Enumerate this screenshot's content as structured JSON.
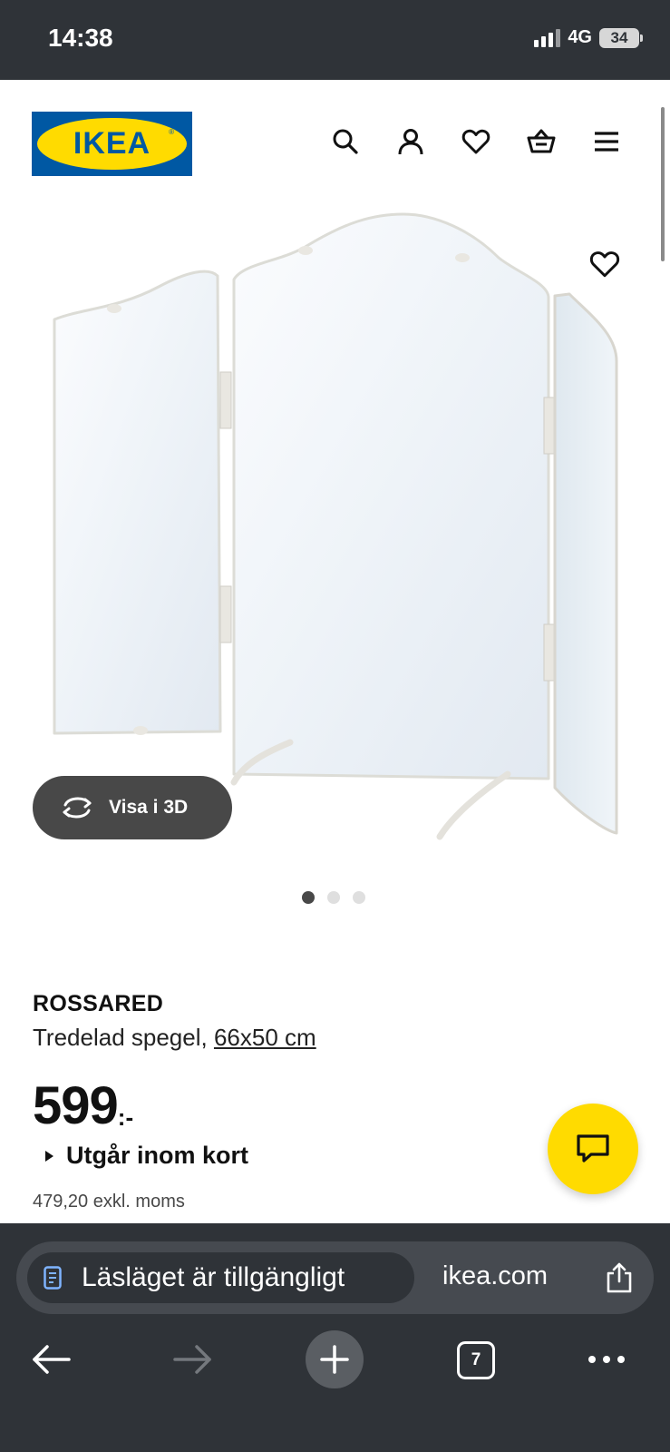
{
  "status_bar": {
    "time": "14:38",
    "network": "4G",
    "battery": "34"
  },
  "header": {
    "logo_text": "IKEA",
    "logo_reg": "®",
    "icons": [
      "search-icon",
      "account-icon",
      "wishlist-icon",
      "cart-icon",
      "menu-icon"
    ]
  },
  "gallery": {
    "view_3d_label": "Visa i 3D",
    "image_count": 3,
    "active_index": 0
  },
  "product": {
    "name": "ROSSARED",
    "description": "Tredelad spegel,",
    "size_link": "66x50 cm",
    "price": "599",
    "price_suffix": ":-",
    "availability": "Utgår inom kort",
    "price_ex_vat": "479,20 exkl. moms"
  },
  "browser": {
    "reader_label": "Läsläget är tillgängligt",
    "domain": "ikea.com",
    "tab_count": "7"
  },
  "colors": {
    "ikea_blue": "#0058a3",
    "ikea_yellow": "#ffdb00",
    "chrome_dark": "#2f3338"
  }
}
